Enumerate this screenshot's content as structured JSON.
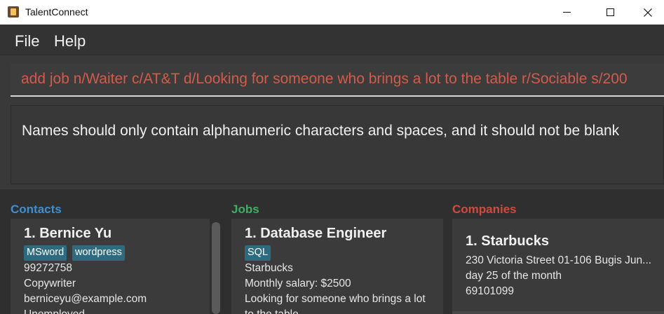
{
  "window": {
    "title": "TalentConnect",
    "icon": "app-icon",
    "controls": [
      "minimize-icon",
      "maximize-icon",
      "close-icon"
    ]
  },
  "menu": {
    "file_label": "File",
    "help_label": "Help"
  },
  "command": {
    "value": "add job n/Waiter c/AT&T d/Looking for someone who brings a lot to the table r/Sociable s/200",
    "color": "#d25b4b"
  },
  "result": {
    "message": "Names should only contain alphanumeric characters and spaces, and it should not be blank"
  },
  "panels": {
    "contacts": {
      "title": "Contacts",
      "color": "#3f8fd0",
      "cards": [
        {
          "heading": "1. Bernice Yu",
          "tags": [
            "MSword",
            "wordpress"
          ],
          "phone": "99272758",
          "role": "Copywriter",
          "email": "berniceyu@example.com",
          "status": "Unemployed"
        }
      ]
    },
    "jobs": {
      "title": "Jobs",
      "color": "#3cb061",
      "cards": [
        {
          "heading": "1. Database Engineer",
          "tags": [
            "SQL"
          ],
          "company": "Starbucks",
          "salary": "Monthly salary: $2500",
          "description_line1": "Looking for someone who brings a lot",
          "description_line2": "to the table"
        }
      ]
    },
    "companies": {
      "title": "Companies",
      "color": "#d24a3f",
      "cards": [
        {
          "heading": "1. Starbucks",
          "address": "230 Victoria Street 01-106 Bugis Jun...",
          "billing": "day 25 of the month",
          "phone": "69101099"
        }
      ]
    }
  }
}
